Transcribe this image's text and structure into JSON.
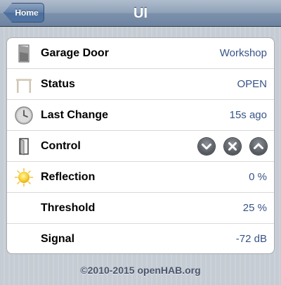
{
  "navbar": {
    "back_label": "Home",
    "title": "UI"
  },
  "items": [
    {
      "label": "Garage Door",
      "value": "Workshop",
      "icon": "garage-door-icon"
    },
    {
      "label": "Status",
      "value": "OPEN",
      "icon": "gate-open-icon"
    },
    {
      "label": "Last Change",
      "value": "15s ago",
      "icon": "clock-icon"
    },
    {
      "label": "Control",
      "value": "",
      "icon": "door-icon",
      "controls": [
        "chevron-down-icon",
        "stop-icon",
        "chevron-up-icon"
      ]
    },
    {
      "label": "Reflection",
      "value": "0 %",
      "icon": "sun-icon"
    },
    {
      "label": "Threshold",
      "value": "25 %",
      "icon": ""
    },
    {
      "label": "Signal",
      "value": "-72 dB",
      "icon": ""
    }
  ],
  "footer": {
    "text": "©2010-2015 openHAB.org"
  }
}
